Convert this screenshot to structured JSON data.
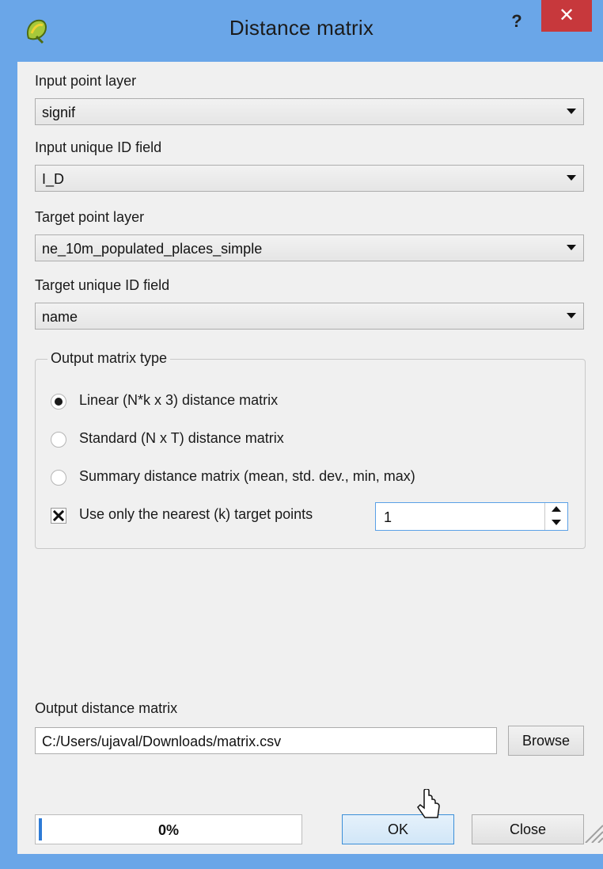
{
  "window": {
    "title": "Distance matrix",
    "help_label": "?",
    "close_label": "✕",
    "app_icon": "qgis-logo-icon"
  },
  "form": {
    "input_point_layer": {
      "label": "Input point layer",
      "value": "signif"
    },
    "input_unique_id": {
      "label": "Input unique ID field",
      "value": "I_D"
    },
    "target_point_layer": {
      "label": "Target point layer",
      "value": "ne_10m_populated_places_simple"
    },
    "target_unique_id": {
      "label": "Target unique ID field",
      "value": "name"
    }
  },
  "matrix_type": {
    "title": "Output matrix type",
    "options": [
      {
        "label": "Linear (N*k x 3) distance matrix",
        "checked": true
      },
      {
        "label": "Standard (N x T) distance matrix",
        "checked": false
      },
      {
        "label": "Summary distance matrix (mean, std. dev., min, max)",
        "checked": false
      }
    ],
    "nearest": {
      "label": "Use only the nearest (k) target points",
      "checked": true,
      "value": "1"
    }
  },
  "output": {
    "label": "Output distance matrix",
    "path": "C:/Users/ujaval/Downloads/matrix.csv",
    "browse_label": "Browse"
  },
  "progress": {
    "text": "0%",
    "value": 0
  },
  "buttons": {
    "ok_label": "OK",
    "close_label": "Close"
  },
  "colors": {
    "titlebar": "#6aa6e8",
    "close_button": "#c7383c",
    "dialog_bg": "#f0f0f0",
    "focus_border": "#5aa0e6"
  }
}
